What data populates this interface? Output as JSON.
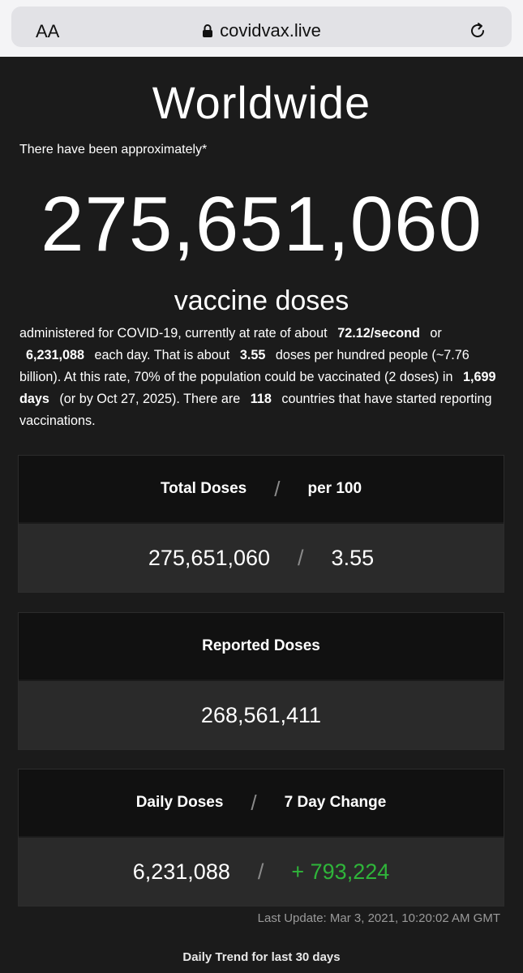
{
  "browser": {
    "aa_label": "AA",
    "url": "covidvax.live"
  },
  "page": {
    "title": "Worldwide",
    "intro": "There have been approximately*",
    "total_doses": "275,651,060",
    "unit": "vaccine doses",
    "desc": {
      "p1": "administered for COVID-19, currently at rate of about",
      "rate": "72.12/second",
      "p2": "or",
      "daily": "6,231,088",
      "p3": "each day.  That is about",
      "per100": "3.55",
      "p4": "doses per hundred people (~7.76 billion).  At this rate, 70% of the population could be vaccinated (2 doses) in",
      "days": "1,699 days",
      "p5": "(or by Oct 27, 2025).  There are",
      "countries": "118",
      "p6": "countries that have started reporting vaccinations."
    }
  },
  "cards": {
    "total": {
      "header_left": "Total Doses",
      "header_right": "per 100",
      "value_left": "275,651,060",
      "value_right": "3.55"
    },
    "reported": {
      "header": "Reported Doses",
      "value": "268,561,411"
    },
    "daily": {
      "header_left": "Daily Doses",
      "header_right": "7 Day Change",
      "value_left": "6,231,088",
      "value_right": "+ 793,224",
      "change_color": "#2fb53a"
    },
    "slash": "/"
  },
  "footer": {
    "last_update": "Last Update: Mar 3, 2021, 10:20:02 AM GMT",
    "trend_title": "Daily Trend for last 30 days"
  }
}
